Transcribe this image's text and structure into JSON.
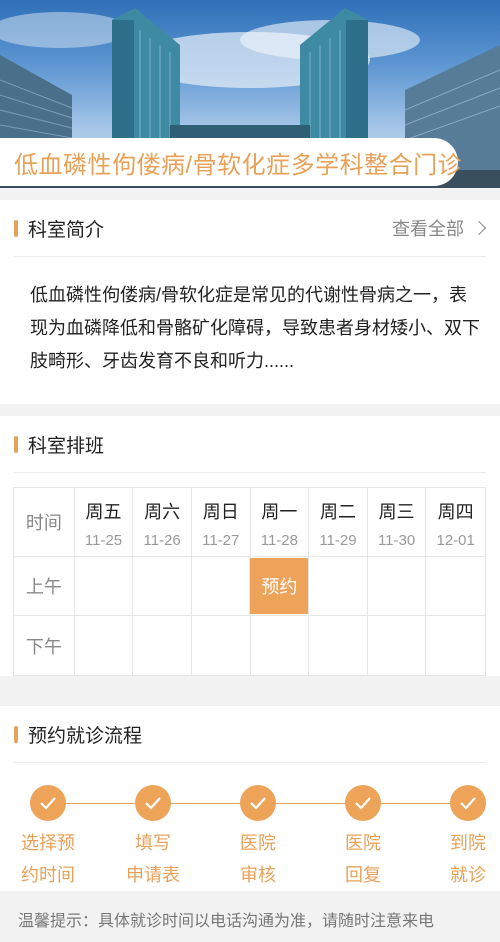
{
  "banner": {
    "title": "低血磷性佝偻病/骨软化症多学科整合门诊"
  },
  "intro": {
    "heading": "科室简介",
    "more_label": "查看全部",
    "text": "低血磷性佝偻病/骨软化症是常见的代谢性骨病之一，表现为血磷降低和骨骼矿化障碍，导致患者身材矮小、双下肢畸形、牙齿发育不良和听力......"
  },
  "schedule": {
    "heading": "科室排班",
    "time_label": "时间",
    "days": [
      {
        "day": "周五",
        "date": "11-25"
      },
      {
        "day": "周六",
        "date": "11-26"
      },
      {
        "day": "周日",
        "date": "11-27"
      },
      {
        "day": "周一",
        "date": "11-28"
      },
      {
        "day": "周二",
        "date": "11-29"
      },
      {
        "day": "周三",
        "date": "11-30"
      },
      {
        "day": "周四",
        "date": "12-01"
      }
    ],
    "morning_label": "上午",
    "afternoon_label": "下午",
    "book_label": "预约"
  },
  "process": {
    "heading": "预约就诊流程",
    "steps": [
      {
        "line1": "选择预",
        "line2": "约时间"
      },
      {
        "line1": "填写",
        "line2": "申请表"
      },
      {
        "line1": "医院",
        "line2": "审核"
      },
      {
        "line1": "医院",
        "line2": "回复"
      },
      {
        "line1": "到院",
        "line2": "就诊"
      }
    ]
  },
  "tip": "温馨提示：具体就诊时间以电话沟通为准，请随时注意来电",
  "colors": {
    "accent": "#e8a158",
    "button": "#eea35a"
  },
  "icons": {
    "step": "check-icon",
    "more": "chevron-right-icon"
  }
}
